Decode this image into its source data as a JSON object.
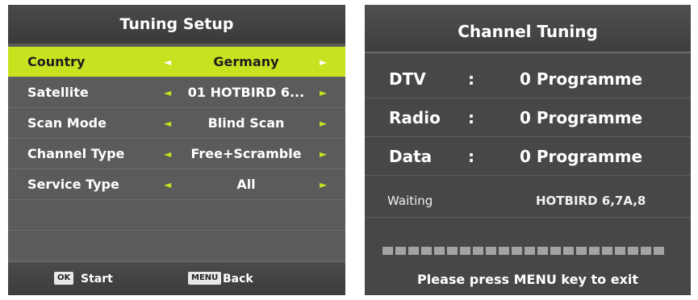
{
  "tuning_setup": {
    "title": "Tuning Setup",
    "rows": [
      {
        "label": "Country",
        "value": "Germany"
      },
      {
        "label": "Satellite",
        "value": "01 HOTBIRD 6..."
      },
      {
        "label": "Scan Mode",
        "value": "Blind Scan"
      },
      {
        "label": "Channel Type",
        "value": "Free+Scramble"
      },
      {
        "label": "Service Type",
        "value": "All"
      }
    ],
    "left_arrow": "◄",
    "right_arrow": "►",
    "footer": {
      "ok_key": "OK",
      "ok_label": "Start",
      "menu_key": "MENU",
      "menu_label": "Back"
    },
    "selected_color": "#c8e21f"
  },
  "channel_tuning": {
    "title": "Channel Tuning",
    "rows": [
      {
        "label": "DTV",
        "sep": ":",
        "value": "0 Programme"
      },
      {
        "label": "Radio",
        "sep": ":",
        "value": "0 Programme"
      },
      {
        "label": "Data",
        "sep": ":",
        "value": "0 Programme"
      }
    ],
    "status": {
      "label": "Waiting",
      "value": "HOTBIRD 6,7A,8"
    },
    "progress": 0,
    "footer": "Please press MENU key to exit"
  }
}
